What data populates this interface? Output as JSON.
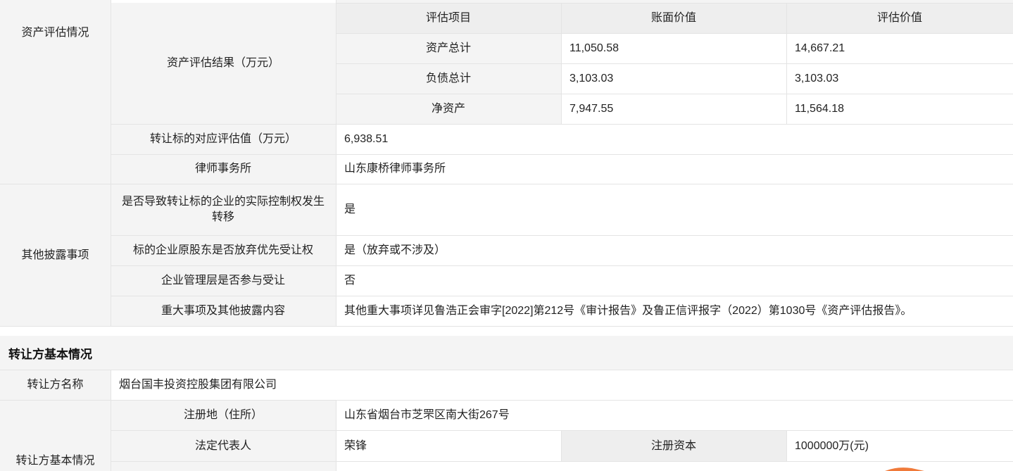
{
  "asset_eval": {
    "group_label": "资产评估情况",
    "result_label": "资产评估结果（万元）",
    "table_headers": [
      "评估项目",
      "账面价值",
      "评估价值"
    ],
    "rows": [
      {
        "item": "资产总计",
        "book": "11,050.58",
        "appraised": "14,667.21"
      },
      {
        "item": "负债总计",
        "book": "3,103.03",
        "appraised": "3,103.03"
      },
      {
        "item": "净资产",
        "book": "7,947.55",
        "appraised": "11,564.18"
      }
    ],
    "target_value_label": "转让标的对应评估值（万元）",
    "target_value": "6,938.51",
    "law_firm_label": "律师事务所",
    "law_firm": "山东康桥律师事务所"
  },
  "other_disclosures": {
    "group_label": "其他披露事项",
    "items": [
      {
        "label": "是否导致转让标的企业的实际控制权发生转移",
        "value": "是"
      },
      {
        "label": "标的企业原股东是否放弃优先受让权",
        "value": "是（放弃或不涉及）"
      },
      {
        "label": "企业管理层是否参与受让",
        "value": "否"
      },
      {
        "label": "重大事项及其他披露内容",
        "value": "其他重大事项详见鲁浩正会审字[2022]第212号《审计报告》及鲁正信评报字（2022）第1030号《资产评估报告》。"
      }
    ]
  },
  "transferor": {
    "section_title": "转让方基本情况",
    "name_label": "转让方名称",
    "name": "烟台国丰投资控股集团有限公司",
    "group_label": "转让方基本情况",
    "address_label": "注册地（住所）",
    "address": "山东省烟台市芝罘区南大街267号",
    "legal_rep_label": "法定代表人",
    "legal_rep": "荣锋",
    "capital_label": "注册资本",
    "capital": "1000000万(元)"
  },
  "colors": {
    "label_bg": "#f4f4f4",
    "header_bg": "#eeeeee",
    "border": "#e4e4e4",
    "accent": "#f07a3a"
  }
}
